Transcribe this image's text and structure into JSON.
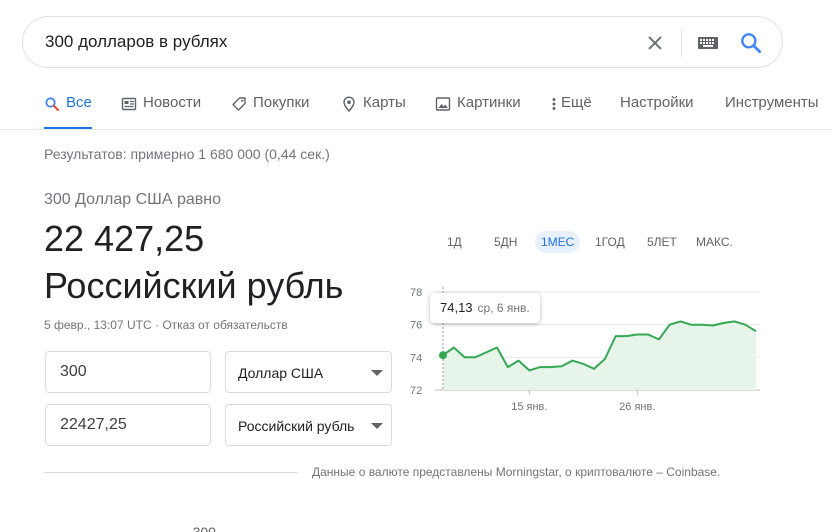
{
  "search": {
    "query": "300 долларов в рублях"
  },
  "tabs": [
    {
      "label": "Все",
      "icon": "search-icon",
      "active": true
    },
    {
      "label": "Новости",
      "icon": "newspaper-icon"
    },
    {
      "label": "Покупки",
      "icon": "tag-icon"
    },
    {
      "label": "Карты",
      "icon": "map-pin-icon"
    },
    {
      "label": "Картинки",
      "icon": "image-icon"
    },
    {
      "label": "Ещё",
      "icon": "more-vert-icon"
    },
    {
      "label": "Настройки"
    },
    {
      "label": "Инструменты"
    }
  ],
  "results_stats": "Результатов: примерно 1 680 000 (0,44 сек.)",
  "converter": {
    "label": "300 Доллар США равно",
    "value": "22 427,25",
    "unit": "Российский рубль",
    "meta_date": "5 февр., 13:07 UTC",
    "meta_sep": " · ",
    "disclaimer": "Отказ от обязательств",
    "from_amount": "300",
    "from_currency": "Доллар США",
    "to_amount": "22427,25",
    "to_currency": "Российский рубль",
    "source_note": "Данные о валюте представлены Morningstar, о криптовалюте – Coinbase."
  },
  "ranges": [
    {
      "label": "1Д"
    },
    {
      "label": "5ДН"
    },
    {
      "label": "1МЕС",
      "active": true
    },
    {
      "label": "1ГОД"
    },
    {
      "label": "5ЛЕТ"
    },
    {
      "label": "МАКС."
    }
  ],
  "tooltip": {
    "value": "74,13",
    "date": "ср, 6 янв."
  },
  "bottom_cut_text": "… … ..  … …  …  …  …  .. 300",
  "chart_data": {
    "type": "area",
    "y_ticks": [
      "78",
      "76",
      "74",
      "72"
    ],
    "y_tick_values": [
      78,
      76,
      74,
      72
    ],
    "ylim": [
      72,
      78
    ],
    "x_tick_labels": [
      "15 янв.",
      "26 янв."
    ],
    "x_tick_index": [
      8,
      18
    ],
    "values": [
      74.13,
      74.6,
      74.0,
      74.0,
      74.3,
      74.6,
      73.4,
      73.8,
      73.2,
      73.4,
      73.4,
      73.45,
      73.8,
      73.6,
      73.3,
      73.9,
      75.3,
      75.3,
      75.4,
      75.4,
      75.1,
      76.0,
      76.2,
      76.0,
      76.0,
      75.95,
      76.1,
      76.2,
      76.0,
      75.6
    ],
    "line_color": "#34a853",
    "fill_color": "#e6f4ea",
    "highlight_index": 0
  }
}
